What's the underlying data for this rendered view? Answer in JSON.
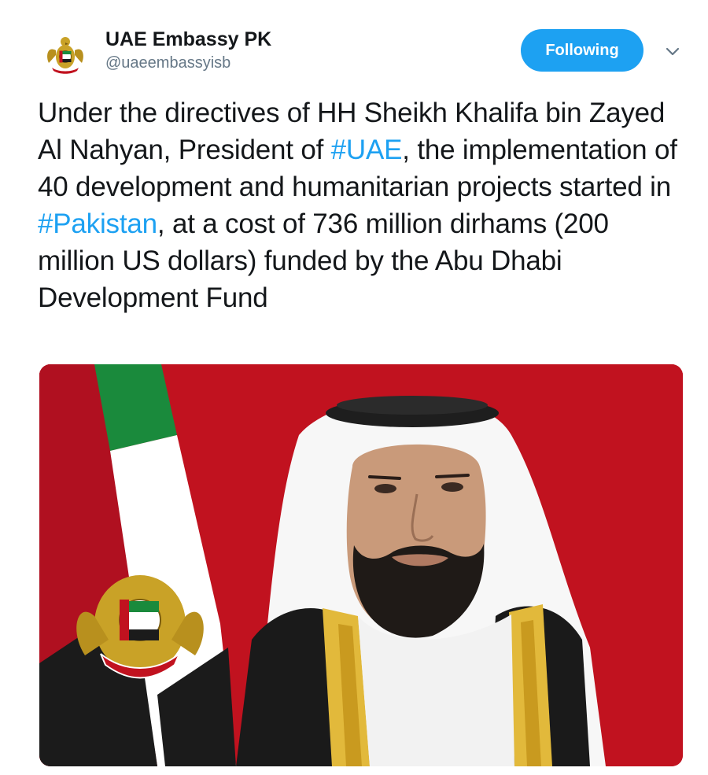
{
  "tweet": {
    "author": {
      "display_name": "UAE Embassy PK",
      "handle": "@uaeembassyisb",
      "avatar_icon": "uae-emblem-icon"
    },
    "follow_button_label": "Following",
    "menu_icon": "chevron-down-icon",
    "text": {
      "part1": "Under the directives of HH Sheikh Khalifa bin Zayed Al Nahyan, President of ",
      "hashtag1": "#UAE",
      "part2": ", the implementation of 40 development and humanitarian projects started in ",
      "hashtag2": "#Pakistan",
      "part3": ", at a cost of 736 million dirhams (200 million US dollars) funded by the Abu Dhabi Development Fund"
    },
    "media": {
      "type": "photo",
      "flag_colors": {
        "red": "#c1121f",
        "green": "#1a8a3c",
        "white": "#ffffff",
        "black": "#1b1b1b"
      }
    }
  },
  "colors": {
    "accent": "#1da1f2",
    "text_primary": "#14171a",
    "text_secondary": "#657786"
  }
}
